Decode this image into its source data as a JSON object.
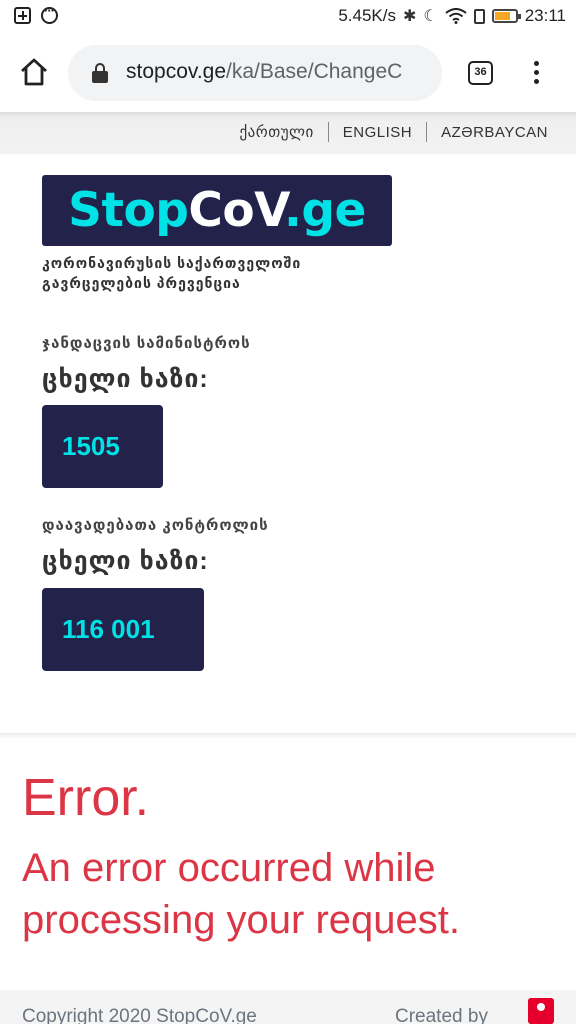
{
  "status_bar": {
    "net_speed": "5.45K/s",
    "time": "23:11",
    "battery_color": "#f5a623"
  },
  "browser": {
    "url_domain": "stopcov.ge",
    "url_path": "/ka/Base/ChangeC",
    "tab_count": "36"
  },
  "languages": [
    {
      "label": "ქართული"
    },
    {
      "label": "ENGLISH"
    },
    {
      "label": "AZƏRBAYCAN"
    }
  ],
  "logo": {
    "part1": "Stop",
    "part2": "CoV",
    "part3": ".ge"
  },
  "subtitle": "კორონავირუსის საქართველოში გავრცელების პრევენცია",
  "ministry_hotline": {
    "label": "ჯანდაცვის სამინისტროს",
    "title": "ცხელი ხაზი:",
    "number": "1505"
  },
  "control_hotline": {
    "label": "დაავადებათა კონტროლის",
    "title": "ცხელი ხაზი:",
    "number": "116 001"
  },
  "error": {
    "title": "Error.",
    "message": "An error occurred while processing your request."
  },
  "footer": {
    "copyright": "Copyright 2020 StopCoV.ge",
    "created_by": "Created by"
  },
  "colors": {
    "brand_dark": "#22224a",
    "brand_cyan": "#00e2e6",
    "error_red": "#dc3545"
  }
}
